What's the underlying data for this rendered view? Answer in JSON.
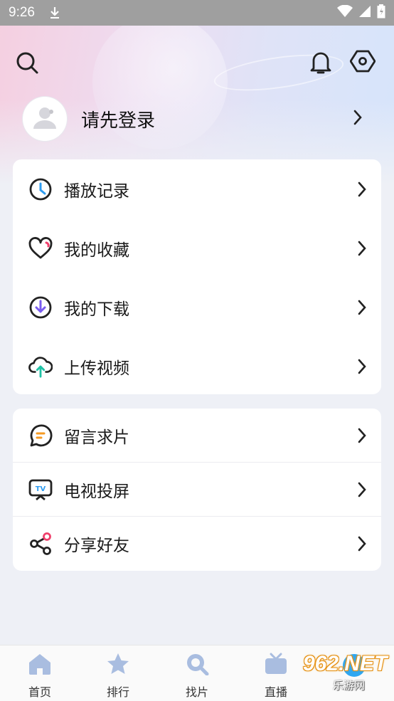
{
  "status_bar": {
    "time": "9:26"
  },
  "header": {
    "search_icon": "search-icon",
    "bell_icon": "bell-icon",
    "settings_icon": "hexagon-settings-icon"
  },
  "login": {
    "label": "请先登录"
  },
  "menu_primary": [
    {
      "label": "播放记录",
      "icon": "clock-icon",
      "color": "#2e9cf0"
    },
    {
      "label": "我的收藏",
      "icon": "heart-icon",
      "color": "#ef3f6b"
    },
    {
      "label": "我的下载",
      "icon": "download-icon",
      "color": "#7a5cf0"
    },
    {
      "label": "上传视频",
      "icon": "cloud-upload-icon",
      "color": "#1fc2a6"
    }
  ],
  "menu_secondary": [
    {
      "label": "留言求片",
      "icon": "message-icon",
      "color": "#f59a23"
    },
    {
      "label": "电视投屏",
      "icon": "tv-icon",
      "color": "#2e9cf0"
    },
    {
      "label": "分享好友",
      "icon": "share-icon",
      "color": "#ef3f6b"
    }
  ],
  "tabs": [
    {
      "label": "首页",
      "icon": "home-icon"
    },
    {
      "label": "排行",
      "icon": "star-icon"
    },
    {
      "label": "找片",
      "icon": "search-icon"
    },
    {
      "label": "直播",
      "icon": "tv-icon"
    }
  ],
  "watermark": {
    "brand": "962.NET",
    "sub": "乐游网"
  },
  "colors": {
    "accent": "#2ea7f2",
    "icon_dark": "#222222",
    "tab_icon": "#9fb3d6"
  }
}
